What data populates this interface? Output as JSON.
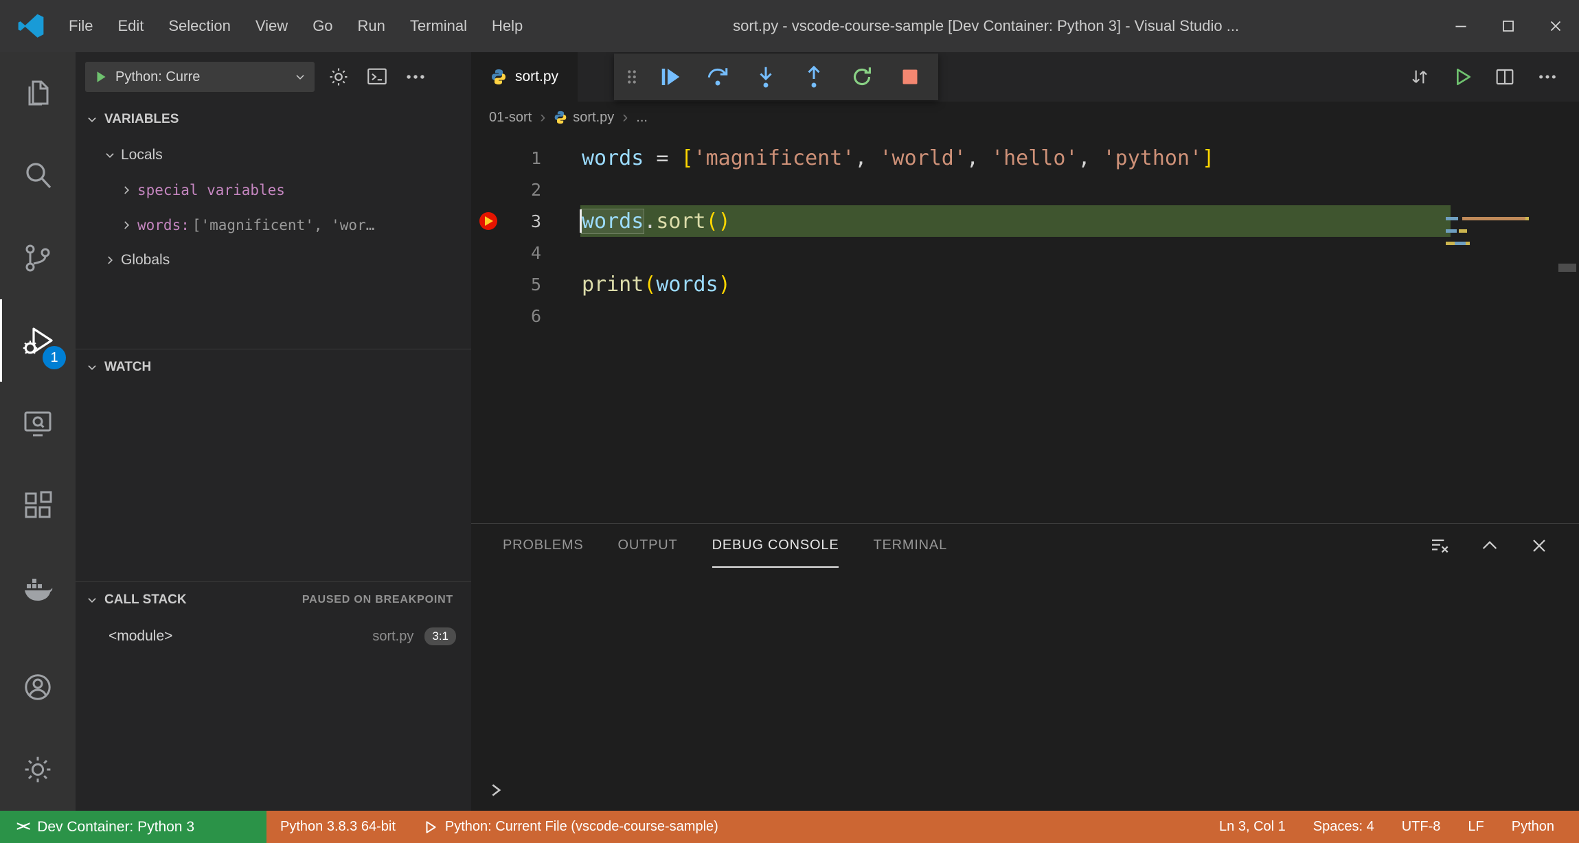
{
  "window": {
    "title": "sort.py - vscode-course-sample [Dev Container: Python 3] - Visual Studio ...",
    "menus": [
      "File",
      "Edit",
      "Selection",
      "View",
      "Go",
      "Run",
      "Terminal",
      "Help"
    ]
  },
  "activity_bar": {
    "items": [
      {
        "name": "explorer"
      },
      {
        "name": "search"
      },
      {
        "name": "source-control"
      },
      {
        "name": "run-and-debug",
        "active": true,
        "badge": "1"
      },
      {
        "name": "remote-explorer"
      },
      {
        "name": "extensions"
      },
      {
        "name": "docker"
      }
    ],
    "bottom_items": [
      {
        "name": "accounts"
      },
      {
        "name": "settings"
      }
    ]
  },
  "sidebar": {
    "toolbar": {
      "config_label": "Python: Curre"
    },
    "variables": {
      "header": "VARIABLES",
      "rows": [
        {
          "kind": "scope",
          "label": "Locals",
          "indent": 1,
          "chevron": "down"
        },
        {
          "kind": "special",
          "label": "special variables",
          "indent": 2,
          "chevron": "right"
        },
        {
          "kind": "variable",
          "name": "words: ",
          "value": "['magnificent', 'wor…",
          "indent": 2,
          "chevron": "right"
        },
        {
          "kind": "scope",
          "label": "Globals",
          "indent": 1,
          "chevron": "right"
        }
      ]
    },
    "watch": {
      "header": "WATCH"
    },
    "call_stack": {
      "header": "CALL STACK",
      "status": "PAUSED ON BREAKPOINT",
      "frames": [
        {
          "name": "<module>",
          "file": "sort.py",
          "position": "3:1"
        }
      ]
    }
  },
  "editor": {
    "tabs": [
      {
        "label": "sort.py",
        "active": true
      }
    ],
    "breadcrumbs": [
      {
        "label": "01-sort"
      },
      {
        "label": "sort.py",
        "icon": "python"
      },
      {
        "label": "..."
      }
    ],
    "code": {
      "lines": [
        {
          "num": 1,
          "tokens": [
            [
              "words",
              "v"
            ],
            [
              " = ",
              "p"
            ],
            [
              "[",
              "b"
            ],
            [
              "'magnificent'",
              "s"
            ],
            [
              ", ",
              "p"
            ],
            [
              "'world'",
              "s"
            ],
            [
              ", ",
              "p"
            ],
            [
              "'hello'",
              "s"
            ],
            [
              ", ",
              "p"
            ],
            [
              "'python'",
              "s"
            ],
            [
              "]",
              "b"
            ]
          ]
        },
        {
          "num": 2,
          "tokens": []
        },
        {
          "num": 3,
          "current": true,
          "breakpoint": true,
          "tokens": [
            [
              "words",
              "v",
              "box"
            ],
            [
              ".",
              "p"
            ],
            [
              "sort",
              "f"
            ],
            [
              "()",
              "b"
            ]
          ]
        },
        {
          "num": 4,
          "tokens": []
        },
        {
          "num": 5,
          "tokens": [
            [
              "print",
              "f"
            ],
            [
              "(",
              "b"
            ],
            [
              "words",
              "v"
            ],
            [
              ")",
              "b"
            ]
          ]
        },
        {
          "num": 6,
          "tokens": []
        }
      ]
    }
  },
  "panel": {
    "tabs": [
      {
        "label": "PROBLEMS"
      },
      {
        "label": "OUTPUT"
      },
      {
        "label": "DEBUG CONSOLE",
        "active": true
      },
      {
        "label": "TERMINAL"
      }
    ]
  },
  "status_bar": {
    "remote_label": "Dev Container: Python 3",
    "items_left": [
      {
        "label": "Python 3.8.3 64-bit"
      },
      {
        "label": "Python: Current File (vscode-course-sample)",
        "icon": "play"
      }
    ],
    "items_right": [
      "Ln 3, Col 1",
      "Spaces: 4",
      "UTF-8",
      "LF",
      "Python"
    ]
  },
  "colors": {
    "status_debug": "#cc6633",
    "remote_green": "#2b9348",
    "badge_blue": "#007fd4",
    "debug_line_highlight": "#3f552f",
    "breakpoint_red": "#e51400",
    "variable_pink": "#c586c0",
    "syntax": {
      "v": "#9cdcfe",
      "p": "#d4d4d4",
      "s": "#ce9178",
      "f": "#dcdcaa",
      "b": "#ffd700"
    }
  }
}
